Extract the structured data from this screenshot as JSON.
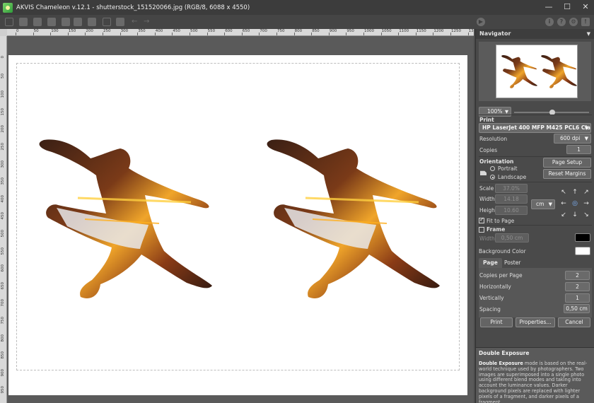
{
  "window": {
    "title": "AKVIS Chameleon v.12.1 - shutterstock_151520066.jpg (RGB/8, 6088 x 4550)",
    "controls": {
      "minimize": "—",
      "maximize": "☐",
      "close": "✕"
    }
  },
  "ruler": {
    "h_labels": [
      "0",
      "50",
      "100",
      "150",
      "200",
      "250",
      "300",
      "350",
      "400",
      "450",
      "500",
      "550",
      "600",
      "650",
      "700",
      "750",
      "800",
      "850",
      "900",
      "950",
      "1000",
      "1050",
      "1100",
      "1150",
      "1200",
      "1250",
      "1300",
      "1350"
    ],
    "v_labels": [
      "0",
      "50",
      "100",
      "150",
      "200",
      "250",
      "300",
      "350",
      "400",
      "450",
      "500",
      "550",
      "600",
      "650",
      "700",
      "750",
      "800",
      "850",
      "900",
      "950"
    ]
  },
  "navigator": {
    "title": "Navigator",
    "zoom": "100%"
  },
  "print": {
    "section": "Print",
    "printer": "HP LaserJet 400 MFP M425 PCL6 Class ...",
    "resolution_label": "Resolution",
    "resolution_value": "600 dpi",
    "copies_label": "Copies",
    "copies_value": "1",
    "orientation_label": "Orientation",
    "portrait_label": "Portrait",
    "landscape_label": "Landscape",
    "page_setup": "Page Setup",
    "reset_margins": "Reset Margins",
    "scale_label": "Scale",
    "scale_value": "37.0%",
    "width_label": "Width",
    "width_value": "14.18",
    "height_label": "Height",
    "height_value": "10.60",
    "unit": "cm",
    "fit_to_page": "Fit to Page",
    "frame_label": "Frame",
    "frame_width_label": "Width",
    "frame_width_value": "0,50 cm",
    "frame_color": "#000000",
    "background_label": "Background Color",
    "background_color": "#ffffff"
  },
  "tabs": {
    "page": "Page",
    "poster": "Poster"
  },
  "page_tab": {
    "copies_per_page_label": "Copies per Page",
    "copies_per_page_value": "2",
    "horizontally_label": "Horizontally",
    "horizontally_value": "2",
    "vertically_label": "Vertically",
    "vertically_value": "1",
    "spacing_label": "Spacing",
    "spacing_value": "0,50 cm"
  },
  "buttons": {
    "print": "Print",
    "properties": "Properties...",
    "cancel": "Cancel"
  },
  "help": {
    "title": "Double Exposure",
    "bold": "Double Exposure",
    "text": " mode is based on the real-world technique used by photographers. Two images are superimposed into a single photo using different blend modes and taking into account the luminance values. Darker background pixels are replaced with lighter pixels of a fragment, and darker pixels of a fragment"
  },
  "toolbar_icons": [
    "open-icon",
    "save-icon",
    "share-icon",
    "print-icon",
    "export-icon",
    "import-icon",
    "printer-icon",
    "layers-icon",
    "crop-icon",
    "brush-icon",
    "undo-icon",
    "redo-icon",
    "run-icon"
  ],
  "toolbar_right_icons": [
    "info-icon",
    "help-icon",
    "settings-icon",
    "tips-icon"
  ]
}
